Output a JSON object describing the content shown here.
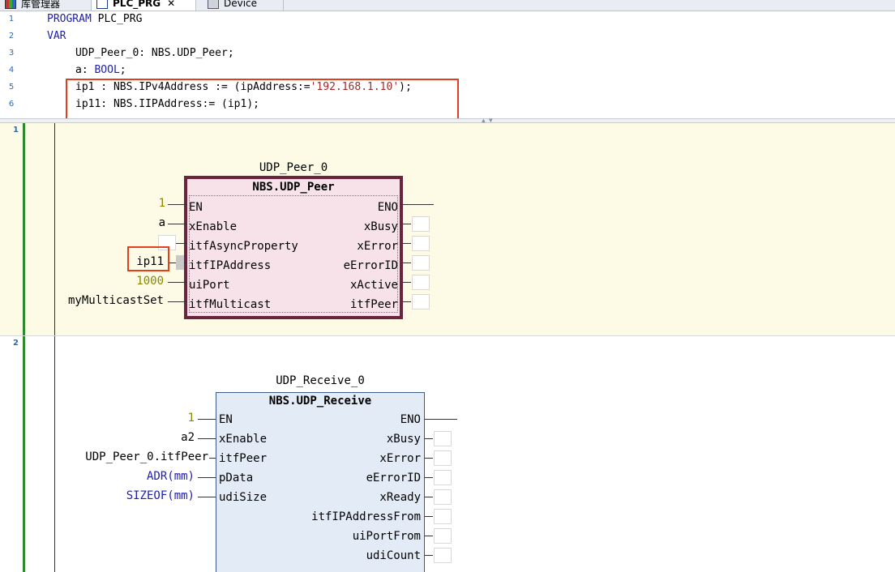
{
  "tabs": {
    "library": "库管理器",
    "program": "PLC_PRG",
    "close": "✕",
    "device": "Device"
  },
  "declaration": {
    "line_numbers": [
      "1",
      "2",
      "3",
      "4",
      "5",
      "6"
    ],
    "lines": [
      {
        "kw": "PROGRAM",
        "rest": " PLC_PRG"
      },
      {
        "kw": "VAR",
        "rest": ""
      },
      {
        "text": "UDP_Peer_0: NBS.UDP_Peer;"
      },
      {
        "pre": "a: ",
        "kw": "BOOL",
        "post": ";"
      },
      {
        "pre": "ip1 : NBS.IPv4Address := (ipAddress:=",
        "str": "'192.168.1.10'",
        "post": ");"
      },
      {
        "text": "ip11: NBS.IIPAddress:= (ip1);"
      }
    ]
  },
  "networks": {
    "n1_label": "1",
    "n2_label": "2"
  },
  "fb1": {
    "instance": "UDP_Peer_0",
    "type": "NBS.UDP_Peer",
    "inputs": [
      "EN",
      "xEnable",
      "itfAsyncProperty",
      "itfIPAddress",
      "uiPort",
      "itfMulticast"
    ],
    "outputs": [
      "ENO",
      "xBusy",
      "xError",
      "eErrorID",
      "xActive",
      "itfPeer"
    ],
    "ext_inputs": [
      "1",
      "a",
      "",
      "ip11",
      "1000",
      "myMulticastSet"
    ]
  },
  "fb2": {
    "instance": "UDP_Receive_0",
    "type": "NBS.UDP_Receive",
    "inputs": [
      "EN",
      "xEnable",
      "itfPeer",
      "pData",
      "udiSize"
    ],
    "outputs": [
      "ENO",
      "xBusy",
      "xError",
      "eErrorID",
      "xReady",
      "itfIPAddressFrom",
      "uiPortFrom",
      "udiCount"
    ],
    "ext_inputs": [
      "1",
      "a2",
      "UDP_Peer_0.itfPeer",
      "ADR(mm)",
      "SIZEOF(mm)"
    ]
  },
  "colors": {
    "highlight_box": "#e0401c",
    "fb1_border": "#6b2440",
    "fb1_fill": "#f6e2e8",
    "fb2_border": "#3c5a86",
    "fb2_fill": "#e3ebf6",
    "network1_bg": "#fdfbe6"
  }
}
